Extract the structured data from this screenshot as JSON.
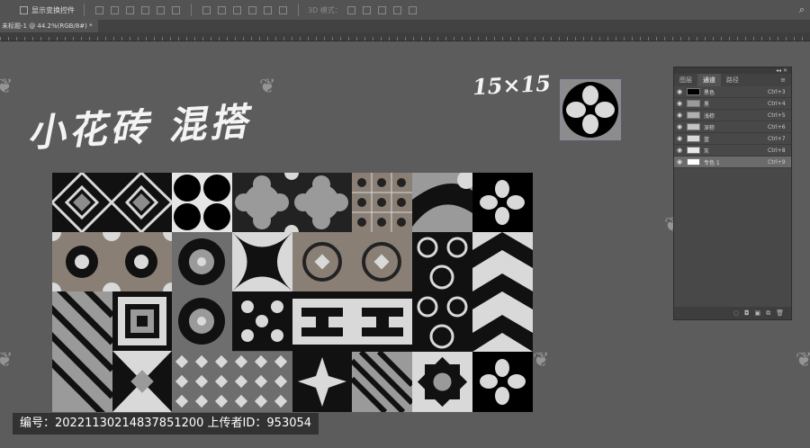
{
  "options_bar": {
    "show_transform_label": "显示变换控件",
    "mode_label": "3D 模式：",
    "search_icon": "search-icon"
  },
  "document": {
    "tab_label": "未标题-1 @ 44.2%(RGB/8#) *"
  },
  "artwork": {
    "title": "小花砖 混搭",
    "size_label": "15×15"
  },
  "watermark_icon": "leaf-logo-icon",
  "channels_panel": {
    "collapse_label": "◂◂ ✕",
    "tabs": [
      {
        "label": "图层",
        "active": false
      },
      {
        "label": "通道",
        "active": true
      },
      {
        "label": "路径",
        "active": false
      }
    ],
    "menu_icon": "hamburger-menu-icon",
    "rows": [
      {
        "name": "黑色",
        "shortcut": "Ctrl+3",
        "thumb": "#000000",
        "selected": false
      },
      {
        "name": "黑",
        "shortcut": "Ctrl+4",
        "thumb": "#9a9a9a",
        "selected": false
      },
      {
        "name": "浅棕",
        "shortcut": "Ctrl+5",
        "thumb": "#b0b0b0",
        "selected": false
      },
      {
        "name": "深棕",
        "shortcut": "Ctrl+6",
        "thumb": "#c4c4c4",
        "selected": false
      },
      {
        "name": "蓝",
        "shortcut": "Ctrl+7",
        "thumb": "#d8d8d8",
        "selected": false
      },
      {
        "name": "灰",
        "shortcut": "Ctrl+8",
        "thumb": "#e8e8e8",
        "selected": false
      },
      {
        "name": "专色 1",
        "shortcut": "Ctrl+9",
        "thumb": "#ffffff",
        "selected": true
      }
    ],
    "footer_icons": [
      "dotted-circle-icon",
      "mask-icon",
      "new-channel-icon",
      "duplicate-icon",
      "trash-icon"
    ]
  },
  "footer": {
    "text": "编号：20221130214837851200 上传者ID：953054"
  },
  "colors": {
    "dark": "#000000",
    "mid": "#8c8c8c",
    "light": "#d9d9d9",
    "brown": "#8a7f74",
    "canvas": "#5c5c5c"
  }
}
